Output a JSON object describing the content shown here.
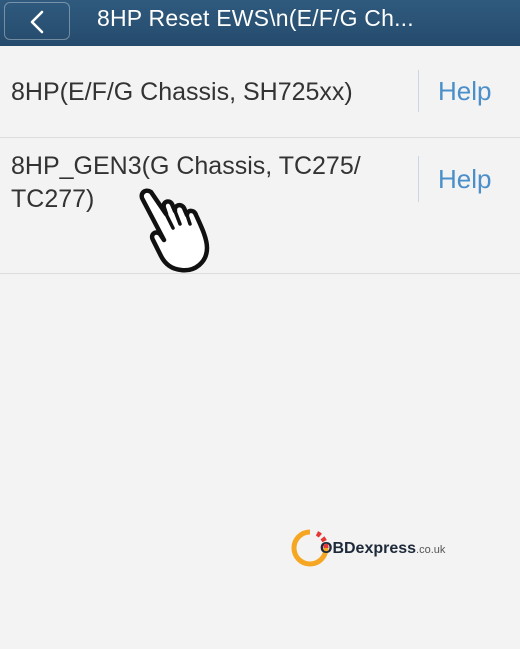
{
  "header": {
    "title": "8HP Reset EWS\\n(E/F/G Ch...",
    "back_icon": "chevron-left-icon"
  },
  "rows": [
    {
      "label": "8HP(E/F/G Chassis, SH725xx)",
      "help_label": "Help"
    },
    {
      "label": "8HP_GEN3(G Chassis, TC275/ TC277)",
      "help_label": "Help"
    }
  ],
  "watermark": {
    "brand": "OBDexpress",
    "domain": ".co.uk"
  },
  "colors": {
    "header_bg": "#2b5476",
    "help_link": "#4a8fc9",
    "background": "#f3f3f3"
  }
}
